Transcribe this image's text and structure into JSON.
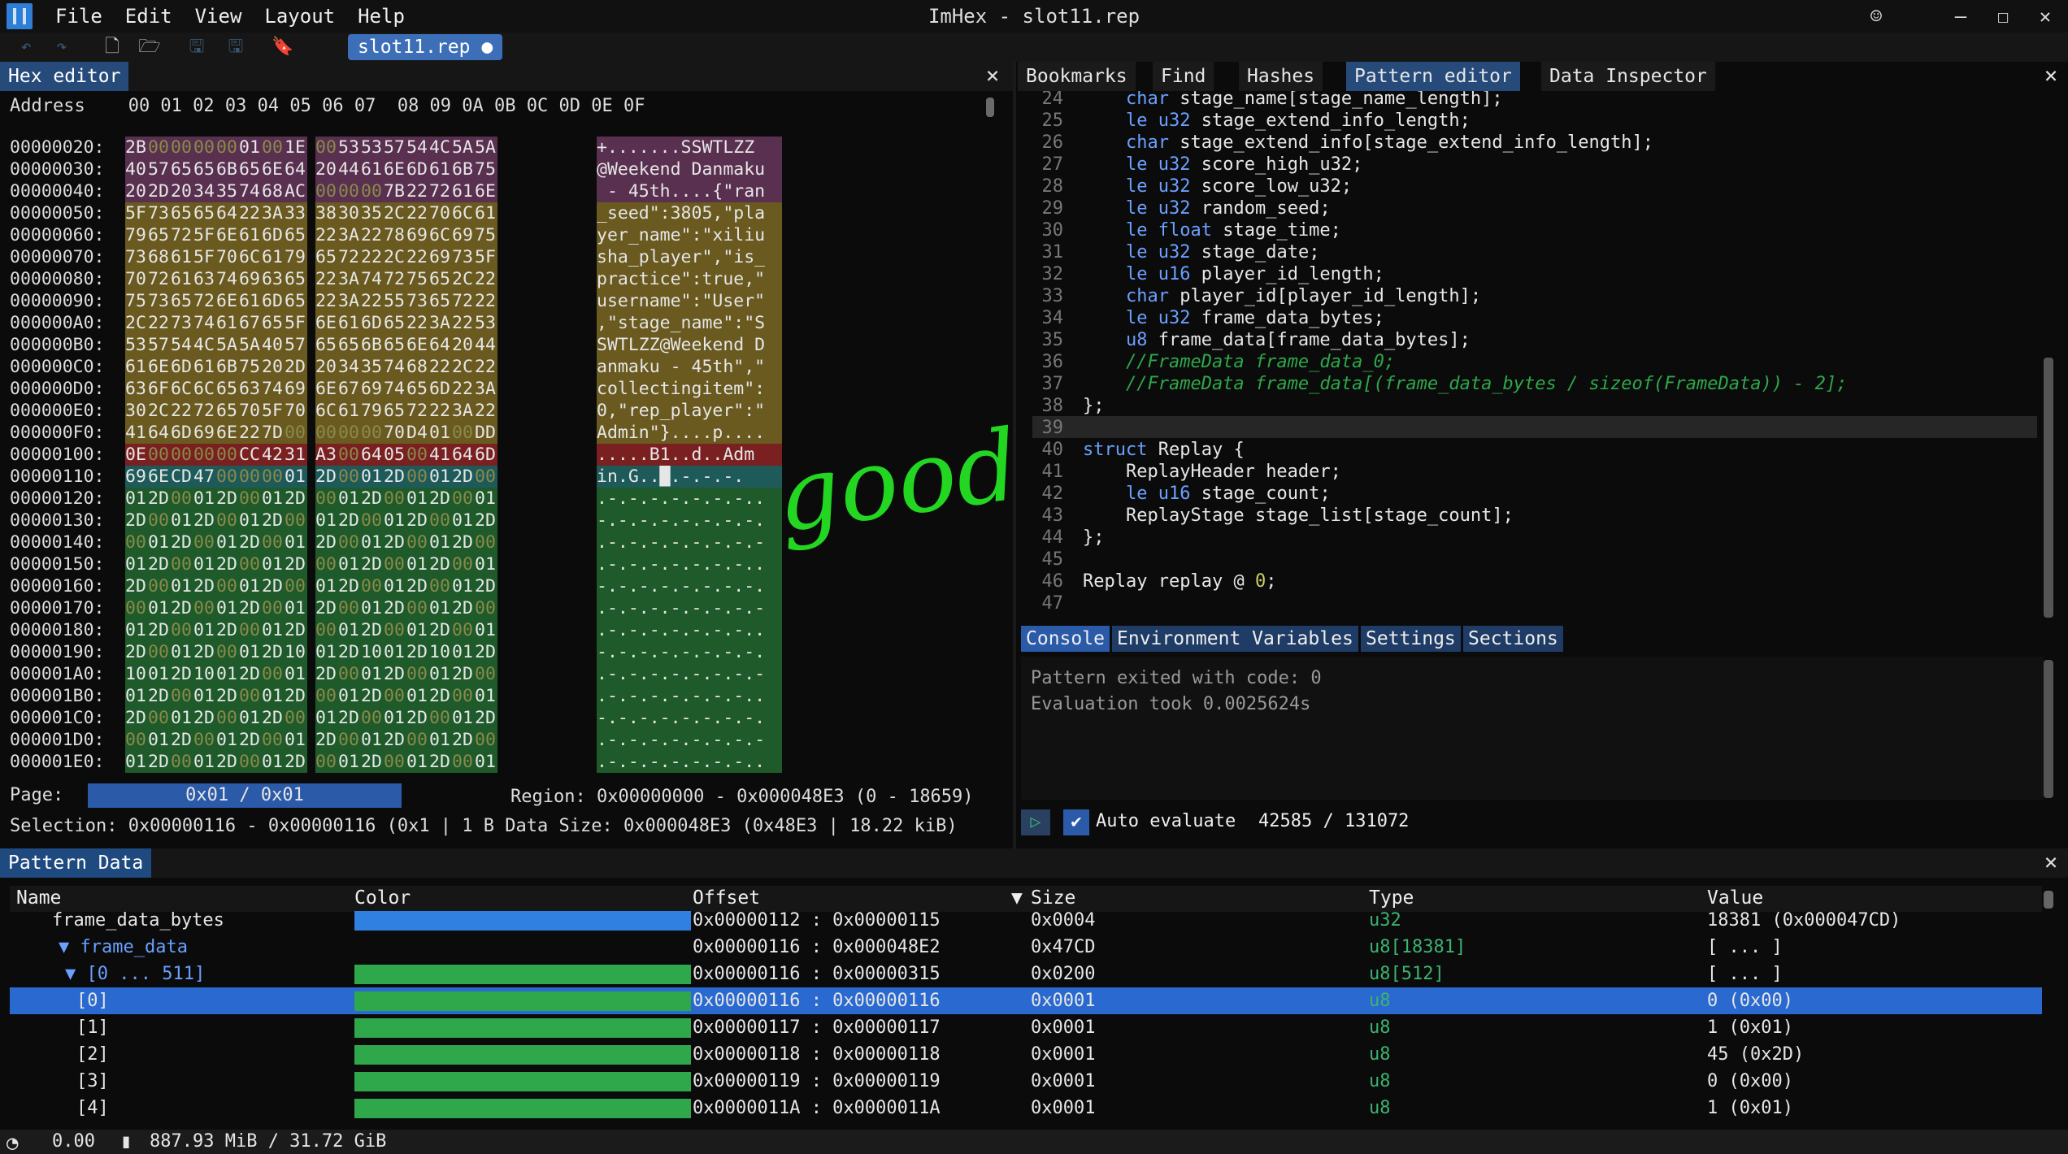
{
  "app": {
    "title": "ImHex - slot11.rep"
  },
  "menu": [
    "File",
    "Edit",
    "View",
    "Layout",
    "Help"
  ],
  "toolbar": {
    "file_tab": "slot11.rep ●"
  },
  "hex_editor": {
    "title": "Hex editor",
    "column_header": "Address    00 01 02 03 04 05 06 07  08 09 0A 0B 0C 0D 0E 0F",
    "rows": [
      {
        "addr": "00000020:",
        "bytes": [
          "2B",
          "00",
          "00",
          "00",
          "00",
          "01",
          "00",
          "1E",
          "00",
          "53",
          "53",
          "57",
          "54",
          "4C",
          "5A",
          "5A"
        ],
        "ascii": "+.......SSWTLZZ"
      },
      {
        "addr": "00000030:",
        "bytes": [
          "40",
          "57",
          "65",
          "65",
          "6B",
          "65",
          "6E",
          "64",
          "20",
          "44",
          "61",
          "6E",
          "6D",
          "61",
          "6B",
          "75"
        ],
        "ascii": "@Weekend Danmaku"
      },
      {
        "addr": "00000040:",
        "bytes": [
          "20",
          "2D",
          "20",
          "34",
          "35",
          "74",
          "68",
          "AC",
          "00",
          "00",
          "00",
          "7B",
          "22",
          "72",
          "61",
          "6E"
        ],
        "ascii": " - 45th....{\"ran"
      },
      {
        "addr": "00000050:",
        "bytes": [
          "5F",
          "73",
          "65",
          "65",
          "64",
          "22",
          "3A",
          "33",
          "38",
          "30",
          "35",
          "2C",
          "22",
          "70",
          "6C",
          "61"
        ],
        "ascii": "_seed\":3805,\"pla"
      },
      {
        "addr": "00000060:",
        "bytes": [
          "79",
          "65",
          "72",
          "5F",
          "6E",
          "61",
          "6D",
          "65",
          "22",
          "3A",
          "22",
          "78",
          "69",
          "6C",
          "69",
          "75"
        ],
        "ascii": "yer_name\":\"xiliu"
      },
      {
        "addr": "00000070:",
        "bytes": [
          "73",
          "68",
          "61",
          "5F",
          "70",
          "6C",
          "61",
          "79",
          "65",
          "72",
          "22",
          "2C",
          "22",
          "69",
          "73",
          "5F"
        ],
        "ascii": "sha_player\",\"is_"
      },
      {
        "addr": "00000080:",
        "bytes": [
          "70",
          "72",
          "61",
          "63",
          "74",
          "69",
          "63",
          "65",
          "22",
          "3A",
          "74",
          "72",
          "75",
          "65",
          "2C",
          "22"
        ],
        "ascii": "practice\":true,\""
      },
      {
        "addr": "00000090:",
        "bytes": [
          "75",
          "73",
          "65",
          "72",
          "6E",
          "61",
          "6D",
          "65",
          "22",
          "3A",
          "22",
          "55",
          "73",
          "65",
          "72",
          "22"
        ],
        "ascii": "username\":\"User\""
      },
      {
        "addr": "000000A0:",
        "bytes": [
          "2C",
          "22",
          "73",
          "74",
          "61",
          "67",
          "65",
          "5F",
          "6E",
          "61",
          "6D",
          "65",
          "22",
          "3A",
          "22",
          "53"
        ],
        "ascii": ",\"stage_name\":\"S"
      },
      {
        "addr": "000000B0:",
        "bytes": [
          "53",
          "57",
          "54",
          "4C",
          "5A",
          "5A",
          "40",
          "57",
          "65",
          "65",
          "6B",
          "65",
          "6E",
          "64",
          "20",
          "44"
        ],
        "ascii": "SWTLZZ@Weekend D"
      },
      {
        "addr": "000000C0:",
        "bytes": [
          "61",
          "6E",
          "6D",
          "61",
          "6B",
          "75",
          "20",
          "2D",
          "20",
          "34",
          "35",
          "74",
          "68",
          "22",
          "2C",
          "22"
        ],
        "ascii": "anmaku - 45th\",\""
      },
      {
        "addr": "000000D0:",
        "bytes": [
          "63",
          "6F",
          "6C",
          "6C",
          "65",
          "63",
          "74",
          "69",
          "6E",
          "67",
          "69",
          "74",
          "65",
          "6D",
          "22",
          "3A"
        ],
        "ascii": "collectingitem\":"
      },
      {
        "addr": "000000E0:",
        "bytes": [
          "30",
          "2C",
          "22",
          "72",
          "65",
          "70",
          "5F",
          "70",
          "6C",
          "61",
          "79",
          "65",
          "72",
          "22",
          "3A",
          "22"
        ],
        "ascii": "0,\"rep_player\":\""
      },
      {
        "addr": "000000F0:",
        "bytes": [
          "41",
          "64",
          "6D",
          "69",
          "6E",
          "22",
          "7D",
          "00",
          "00",
          "00",
          "00",
          "70",
          "D4",
          "01",
          "00",
          "DD"
        ],
        "ascii": "Admin\"}....p...."
      },
      {
        "addr": "00000100:",
        "bytes": [
          "0E",
          "00",
          "00",
          "00",
          "00",
          "CC",
          "42",
          "31",
          "A3",
          "00",
          "64",
          "05",
          "00",
          "41",
          "64",
          "6D"
        ],
        "ascii": ".....B1..d..Adm"
      },
      {
        "addr": "00000110:",
        "bytes": [
          "69",
          "6E",
          "CD",
          "47",
          "00",
          "00",
          "00",
          "01",
          "2D",
          "00",
          "01",
          "2D",
          "00",
          "01",
          "2D",
          "00"
        ],
        "ascii": "in.G..█.-.-.-."
      },
      {
        "addr": "00000120:",
        "bytes": [
          "01",
          "2D",
          "00",
          "01",
          "2D",
          "00",
          "01",
          "2D",
          "00",
          "01",
          "2D",
          "00",
          "01",
          "2D",
          "00",
          "01"
        ],
        "ascii": ".-.-.-.-.-.-.-.."
      },
      {
        "addr": "00000130:",
        "bytes": [
          "2D",
          "00",
          "01",
          "2D",
          "00",
          "01",
          "2D",
          "00",
          "01",
          "2D",
          "00",
          "01",
          "2D",
          "00",
          "01",
          "2D"
        ],
        "ascii": "-.-.-.-.-.-.-.-."
      },
      {
        "addr": "00000140:",
        "bytes": [
          "00",
          "01",
          "2D",
          "00",
          "01",
          "2D",
          "00",
          "01",
          "2D",
          "00",
          "01",
          "2D",
          "00",
          "01",
          "2D",
          "00"
        ],
        "ascii": ".-.-.-.-.-.-.-.-"
      },
      {
        "addr": "00000150:",
        "bytes": [
          "01",
          "2D",
          "00",
          "01",
          "2D",
          "00",
          "01",
          "2D",
          "00",
          "01",
          "2D",
          "00",
          "01",
          "2D",
          "00",
          "01"
        ],
        "ascii": ".-.-.-.-.-.-.-.."
      },
      {
        "addr": "00000160:",
        "bytes": [
          "2D",
          "00",
          "01",
          "2D",
          "00",
          "01",
          "2D",
          "00",
          "01",
          "2D",
          "00",
          "01",
          "2D",
          "00",
          "01",
          "2D"
        ],
        "ascii": "-.-.-.-.-.-.-.-."
      },
      {
        "addr": "00000170:",
        "bytes": [
          "00",
          "01",
          "2D",
          "00",
          "01",
          "2D",
          "00",
          "01",
          "2D",
          "00",
          "01",
          "2D",
          "00",
          "01",
          "2D",
          "00"
        ],
        "ascii": ".-.-.-.-.-.-.-.-"
      },
      {
        "addr": "00000180:",
        "bytes": [
          "01",
          "2D",
          "00",
          "01",
          "2D",
          "00",
          "01",
          "2D",
          "00",
          "01",
          "2D",
          "00",
          "01",
          "2D",
          "00",
          "01"
        ],
        "ascii": ".-.-.-.-.-.-.-.."
      },
      {
        "addr": "00000190:",
        "bytes": [
          "2D",
          "00",
          "01",
          "2D",
          "00",
          "01",
          "2D",
          "10",
          "01",
          "2D",
          "10",
          "01",
          "2D",
          "10",
          "01",
          "2D"
        ],
        "ascii": "-.-.-.-.-.-.-.-."
      },
      {
        "addr": "000001A0:",
        "bytes": [
          "10",
          "01",
          "2D",
          "10",
          "01",
          "2D",
          "00",
          "01",
          "2D",
          "00",
          "01",
          "2D",
          "00",
          "01",
          "2D",
          "00"
        ],
        "ascii": ".-.-.-.-.-.-.-.-"
      },
      {
        "addr": "000001B0:",
        "bytes": [
          "01",
          "2D",
          "00",
          "01",
          "2D",
          "00",
          "01",
          "2D",
          "00",
          "01",
          "2D",
          "00",
          "01",
          "2D",
          "00",
          "01"
        ],
        "ascii": ".-.-.-.-.-.-.-.."
      },
      {
        "addr": "000001C0:",
        "bytes": [
          "2D",
          "00",
          "01",
          "2D",
          "00",
          "01",
          "2D",
          "00",
          "01",
          "2D",
          "00",
          "01",
          "2D",
          "00",
          "01",
          "2D"
        ],
        "ascii": "-.-.-.-.-.-.-.-."
      },
      {
        "addr": "000001D0:",
        "bytes": [
          "00",
          "01",
          "2D",
          "00",
          "01",
          "2D",
          "00",
          "01",
          "2D",
          "00",
          "01",
          "2D",
          "00",
          "01",
          "2D",
          "00"
        ],
        "ascii": ".-.-.-.-.-.-.-.-"
      },
      {
        "addr": "000001E0:",
        "bytes": [
          "01",
          "2D",
          "00",
          "01",
          "2D",
          "00",
          "01",
          "2D",
          "00",
          "01",
          "2D",
          "00",
          "01",
          "2D",
          "00",
          "01"
        ],
        "ascii": ".-.-.-.-.-.-.-.."
      }
    ],
    "annotation": "good!",
    "page_label": "Page:",
    "page_value": "0x01 / 0x01",
    "region": "Region: 0x00000000 - 0x000048E3 (0 - 18659)",
    "selection": "Selection: 0x00000116 - 0x00000116 (0x1 | 1 B Data Size: 0x000048E3 (0x48E3 | 18.22 kiB)"
  },
  "right_tabs": [
    "Bookmarks",
    "Find",
    "Hashes",
    "Pattern editor",
    "Data Inspector"
  ],
  "code_lines": [
    {
      "n": "24",
      "t": "    char stage_name[stage_name_length];"
    },
    {
      "n": "25",
      "t": "    le u32 stage_extend_info_length;"
    },
    {
      "n": "26",
      "t": "    char stage_extend_info[stage_extend_info_length];"
    },
    {
      "n": "27",
      "t": "    le u32 score_high_u32;"
    },
    {
      "n": "28",
      "t": "    le u32 score_low_u32;"
    },
    {
      "n": "29",
      "t": "    le u32 random_seed;"
    },
    {
      "n": "30",
      "t": "    le float stage_time;"
    },
    {
      "n": "31",
      "t": "    le u32 stage_date;"
    },
    {
      "n": "32",
      "t": "    le u16 player_id_length;"
    },
    {
      "n": "33",
      "t": "    char player_id[player_id_length];"
    },
    {
      "n": "34",
      "t": "    le u32 frame_data_bytes;"
    },
    {
      "n": "35",
      "t": "    u8 frame_data[frame_data_bytes];"
    },
    {
      "n": "36",
      "t": "    //FrameData frame_data_0;"
    },
    {
      "n": "37",
      "t": "    //FrameData frame_data[(frame_data_bytes / sizeof(FrameData)) - 2];"
    },
    {
      "n": "38",
      "t": "};"
    },
    {
      "n": "39",
      "t": ""
    },
    {
      "n": "40",
      "t": "struct Replay {"
    },
    {
      "n": "41",
      "t": "    ReplayHeader header;"
    },
    {
      "n": "42",
      "t": "    le u16 stage_count;"
    },
    {
      "n": "43",
      "t": "    ReplayStage stage_list[stage_count];"
    },
    {
      "n": "44",
      "t": "};"
    },
    {
      "n": "45",
      "t": ""
    },
    {
      "n": "46",
      "t": "Replay replay @ 0;"
    },
    {
      "n": "47",
      "t": ""
    }
  ],
  "console_tabs": [
    "Console",
    "Environment Variables",
    "Settings",
    "Sections"
  ],
  "console_lines": [
    "Pattern exited with code: 0",
    "Evaluation took 0.0025624s"
  ],
  "auto_evaluate": "Auto evaluate",
  "counter": "42585 / 131072",
  "pattern_data": {
    "title": "Pattern Data",
    "columns": [
      "Name",
      "Color",
      "Offset",
      "Size",
      "Type",
      "Value"
    ],
    "rows": [
      {
        "name": "frame_data_bytes",
        "color": "#2f80e0",
        "offset": "0x00000112 : 0x00000115",
        "size": "0x0004",
        "type": "u32",
        "value": "18381 (0x000047CD)",
        "indent": 44
      },
      {
        "name": "▼ frame_data",
        "color": "",
        "offset": "0x00000116 : 0x000048E2",
        "size": "0x47CD",
        "type": "u8[18381]",
        "value": "[ ... ]",
        "indent": 52
      },
      {
        "name": "▼ [0 ... 511]",
        "color": "#2ea84a",
        "offset": "0x00000116 : 0x00000315",
        "size": "0x0200",
        "type": "u8[512]",
        "value": "[ ... ]",
        "indent": 60
      },
      {
        "name": "[0]",
        "color": "#2ea84a",
        "offset": "0x00000116 : 0x00000116",
        "size": "0x0001",
        "type": "u8",
        "value": "0 (0x00)",
        "indent": 74,
        "selected": true
      },
      {
        "name": "[1]",
        "color": "#2ea84a",
        "offset": "0x00000117 : 0x00000117",
        "size": "0x0001",
        "type": "u8",
        "value": "1 (0x01)",
        "indent": 74
      },
      {
        "name": "[2]",
        "color": "#2ea84a",
        "offset": "0x00000118 : 0x00000118",
        "size": "0x0001",
        "type": "u8",
        "value": "45 (0x2D)",
        "indent": 74
      },
      {
        "name": "[3]",
        "color": "#2ea84a",
        "offset": "0x00000119 : 0x00000119",
        "size": "0x0001",
        "type": "u8",
        "value": "0 (0x00)",
        "indent": 74
      },
      {
        "name": "[4]",
        "color": "#2ea84a",
        "offset": "0x0000011A : 0x0000011A",
        "size": "0x0001",
        "type": "u8",
        "value": "1 (0x01)",
        "indent": 74
      }
    ]
  },
  "status": {
    "fps": "0.00",
    "memory": "887.93 MiB / 31.72 GiB"
  }
}
